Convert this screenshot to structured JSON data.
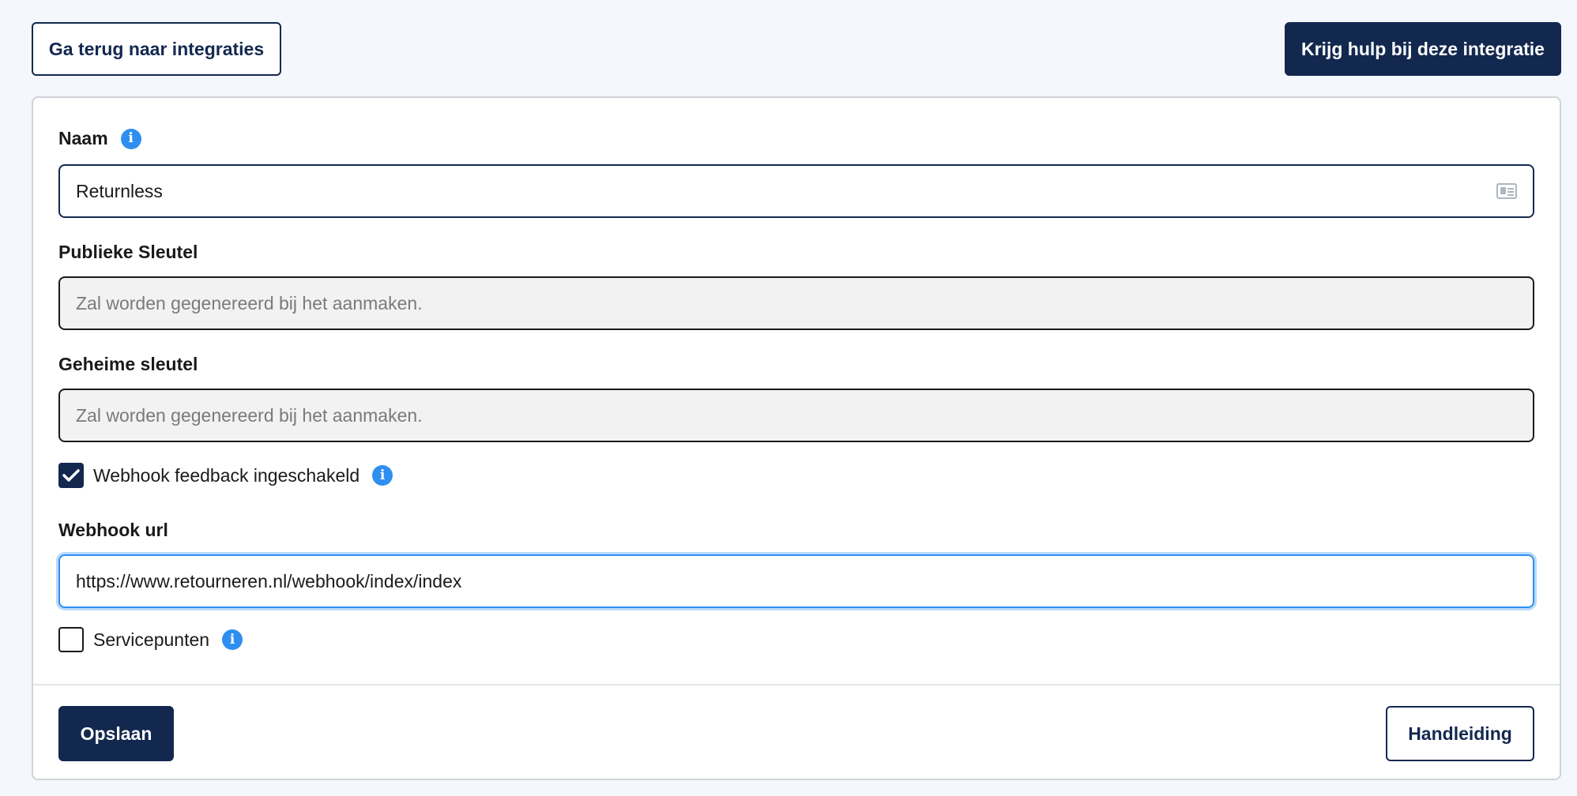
{
  "header": {
    "back_label": "Ga terug naar integraties",
    "help_label": "Krijg hulp bij deze integratie"
  },
  "form": {
    "name": {
      "label": "Naam",
      "value": "Returnless"
    },
    "public_key": {
      "label": "Publieke Sleutel",
      "placeholder": "Zal worden gegenereerd bij het aanmaken."
    },
    "secret_key": {
      "label": "Geheime sleutel",
      "placeholder": "Zal worden gegenereerd bij het aanmaken."
    },
    "webhook_feedback": {
      "label": "Webhook feedback ingeschakeld",
      "checked": true
    },
    "webhook_url": {
      "label": "Webhook url",
      "value": "https://www.retourneren.nl/webhook/index/index"
    },
    "service_points": {
      "label": "Servicepunten",
      "checked": false
    }
  },
  "footer": {
    "save_label": "Opslaan",
    "manual_label": "Handleiding"
  },
  "colors": {
    "primary": "#13284f",
    "info": "#2f8ff0",
    "focus_ring": "#b9dafb",
    "readonly_bg": "#f2f2f2",
    "page_bg": "#f4f7fb"
  },
  "icons": {
    "info": "info-icon",
    "name_field": "id-card-icon",
    "checkmark": "checkmark-icon"
  }
}
